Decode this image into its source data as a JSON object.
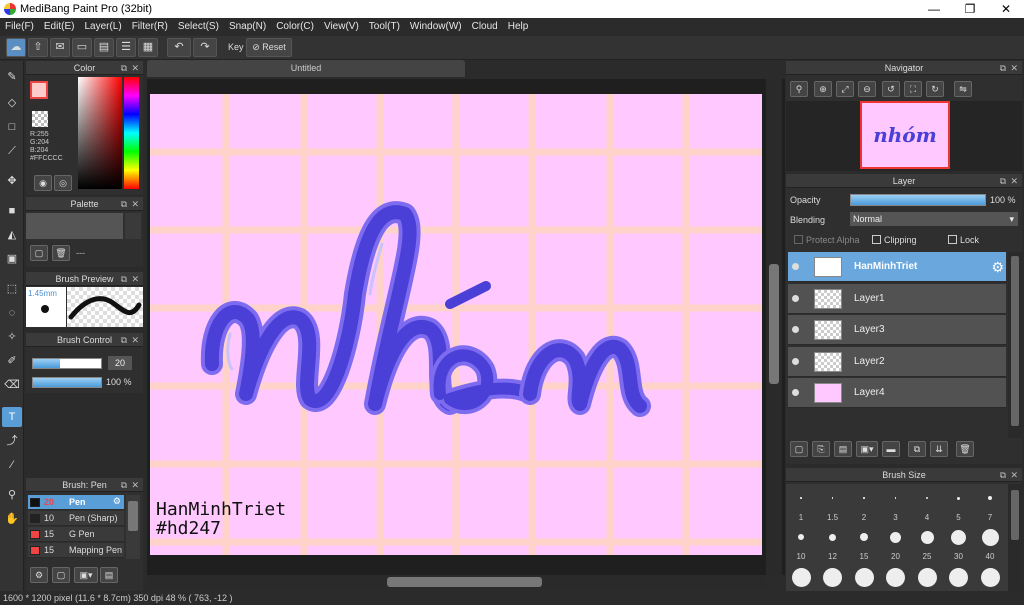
{
  "window": {
    "title": "MediBang Paint Pro (32bit)",
    "min": "—",
    "max": "❐",
    "close": "✕"
  },
  "menu": [
    "File(F)",
    "Edit(E)",
    "Layer(L)",
    "Filter(R)",
    "Select(S)",
    "Snap(N)",
    "Color(C)",
    "View(V)",
    "Tool(T)",
    "Window(W)",
    "Cloud",
    "Help"
  ],
  "toolbar": {
    "key_label": "Key",
    "reset_label": "Reset"
  },
  "doc_tab": "Untitled",
  "color_panel": {
    "title": "Color",
    "r": "R:255",
    "g": "G:204",
    "b": "B:204",
    "hex": "#FFCCCC"
  },
  "palette_panel": {
    "title": "Palette",
    "dashes": "---"
  },
  "brush_preview": {
    "title": "Brush Preview",
    "size": "1.45mm"
  },
  "brush_control": {
    "title": "Brush Control",
    "size_value": "20",
    "opacity_value": "100 %"
  },
  "brush_list": {
    "title": "Brush: Pen",
    "items": [
      {
        "size": "20",
        "name": "Pen"
      },
      {
        "size": "10",
        "name": "Pen (Sharp)"
      },
      {
        "size": "15",
        "name": "G Pen"
      },
      {
        "size": "15",
        "name": "Mapping Pen"
      }
    ]
  },
  "canvas": {
    "signature_line1": "HanMinhTriet",
    "signature_line2": "#hd247",
    "art_text": "nhóm"
  },
  "navigator": {
    "title": "Navigator",
    "thumb_text": "nhóm"
  },
  "layer_panel": {
    "title": "Layer",
    "opacity_label": "Opacity",
    "opacity_value": "100 %",
    "opacity": 1.0,
    "blending_label": "Blending",
    "blending_value": "Normal",
    "protect_alpha": "Protect Alpha",
    "clipping": "Clipping",
    "lock": "Lock",
    "layers": [
      "HanMinhTriet",
      "Layer1",
      "Layer3",
      "Layer2",
      "Layer4"
    ]
  },
  "brush_size_panel": {
    "title": "Brush Size",
    "row1": [
      "1",
      "1.5",
      "2",
      "3",
      "4",
      "5",
      "7"
    ],
    "row2": [
      "10",
      "12",
      "15",
      "20",
      "25",
      "30",
      "40"
    ]
  },
  "status": {
    "text": "1600 * 1200 pixel  (11.6 * 8.7cm)  350 dpi  48 %  ( 763, -12 )"
  },
  "colors": {
    "accent": "#5a9ed8",
    "paper": "#ffc9ff",
    "grid": "#ffd3c9",
    "ink": "#4a3fd6",
    "current_color": "#FFCCCC"
  }
}
